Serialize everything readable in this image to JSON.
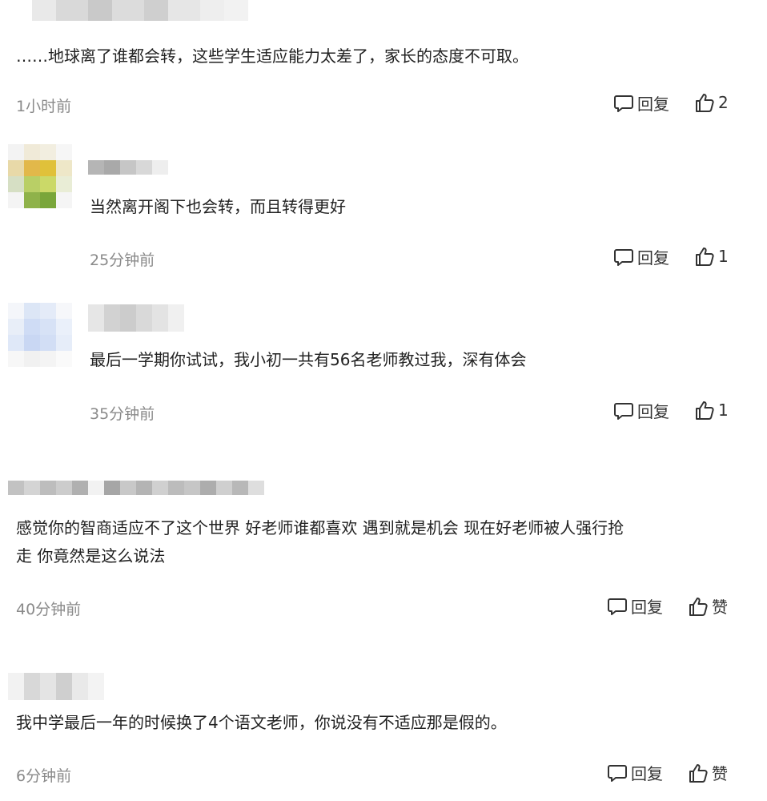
{
  "comments": [
    {
      "text": "……地球离了谁都会转，这些学生适应能力太差了，家长的态度不可取。",
      "time": "1小时前",
      "reply_label": "回复",
      "like_label": "2"
    },
    {
      "text": "当然离开阁下也会转，而且转得更好",
      "time": "25分钟前",
      "reply_label": "回复",
      "like_label": "1"
    },
    {
      "text": "最后一学期你试试，我小初一共有56名老师教过我，深有体会",
      "time": "35分钟前",
      "reply_label": "回复",
      "like_label": "1"
    },
    {
      "text_line1": "感觉你的智商适应不了这个世界 好老师谁都喜欢 遇到就是机会 现在好老师被人强行抢",
      "text_line2": "走 你竟然是这么说法",
      "time": "40分钟前",
      "reply_label": "回复",
      "like_label": "赞"
    },
    {
      "text": "我中学最后一年的时候换了4个语文老师，你说没有不适应那是假的。",
      "time": "6分钟前",
      "reply_label": "回复",
      "like_label": "赞"
    }
  ],
  "icons": {
    "reply": "comment-bubble-icon",
    "like": "thumbs-up-icon"
  },
  "colors": {
    "text": "#222222",
    "time": "#8a8a8a",
    "action": "#333333",
    "background": "#ffffff"
  }
}
